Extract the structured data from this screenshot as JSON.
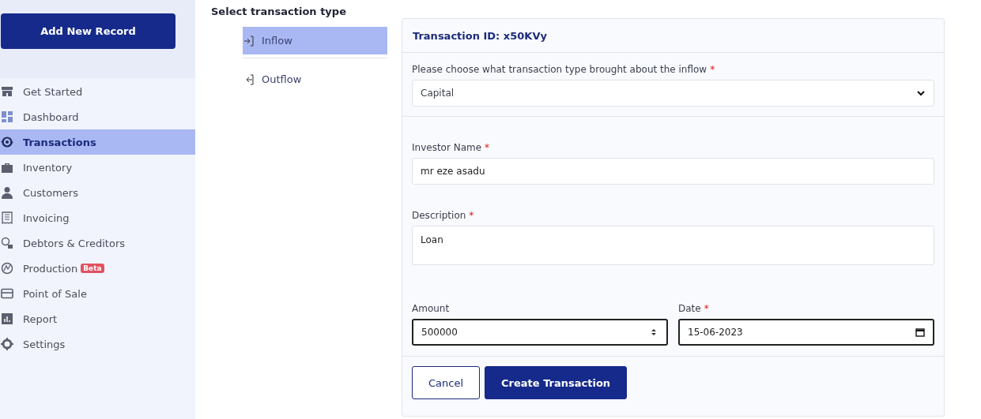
{
  "sidebar": {
    "add_button": "Add New Record",
    "items": [
      {
        "label": "Get Started",
        "selected": false
      },
      {
        "label": "Dashboard",
        "selected": false
      },
      {
        "label": "Transactions",
        "selected": true
      },
      {
        "label": "Inventory",
        "selected": false
      },
      {
        "label": "Customers",
        "selected": false
      },
      {
        "label": "Invoicing",
        "selected": false
      },
      {
        "label": "Debtors & Creditors",
        "selected": false
      },
      {
        "label": "Production",
        "selected": false,
        "badge": "Beta"
      },
      {
        "label": "Point of Sale",
        "selected": false
      },
      {
        "label": "Report",
        "selected": false
      },
      {
        "label": "Settings",
        "selected": false
      }
    ]
  },
  "type_picker": {
    "title": "Select transaction type",
    "tabs": [
      {
        "label": "Inflow",
        "kind": "in",
        "selected": true
      },
      {
        "label": "Outflow",
        "kind": "out",
        "selected": false
      }
    ]
  },
  "form": {
    "header": "Transaction ID: x50KVy",
    "type_select": {
      "label": "Please choose what transaction type brought about the inflow",
      "required_mark": "*",
      "value": "Capital"
    },
    "investor": {
      "label": "Investor Name",
      "required_mark": "*",
      "value": "mr eze asadu",
      "focused": false
    },
    "description": {
      "label": "Description",
      "required_mark": "*",
      "value": "Loan"
    },
    "amount": {
      "label": "Amount",
      "value": "500000",
      "focused": true
    },
    "date": {
      "label": "Date",
      "required_mark": "*",
      "value": "15-06-2023",
      "focused": true
    },
    "buttons": [
      {
        "label": "Cancel",
        "kind": "secondary"
      },
      {
        "label": "Create Transaction",
        "kind": "primary"
      }
    ]
  }
}
